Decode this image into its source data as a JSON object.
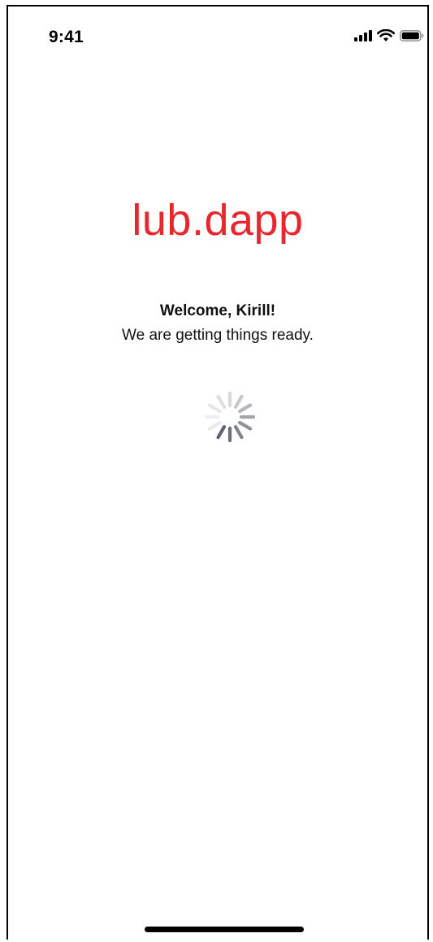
{
  "status_bar": {
    "time": "9:41",
    "icons": [
      "cellular-signal-icon",
      "wifi-icon",
      "battery-icon"
    ]
  },
  "logo": {
    "text": "lub.dapp",
    "color": "#e8262d"
  },
  "welcome": {
    "greeting": "Welcome, Kirill!",
    "message": "We are getting things ready."
  },
  "loading": {
    "indicator": "activity-spinner-icon"
  }
}
